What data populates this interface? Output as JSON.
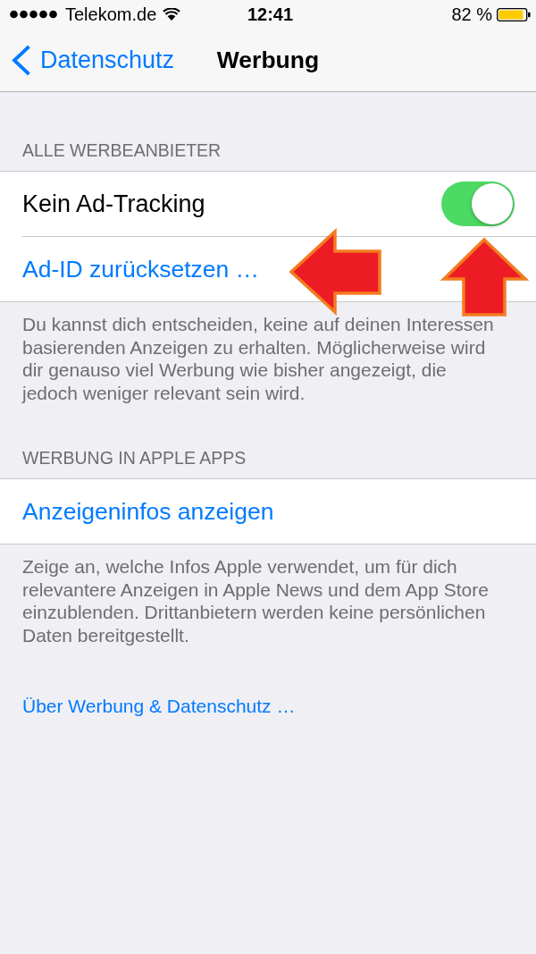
{
  "status_bar": {
    "carrier": "Telekom.de",
    "time": "12:41",
    "battery": "82 %"
  },
  "nav_bar": {
    "back": "Datenschutz",
    "title": "Werbung"
  },
  "sections": [
    {
      "header": "ALLE WERBEANBIETER",
      "rows": [
        {
          "kind": "toggle",
          "label": "Kein Ad-Tracking",
          "on": true
        },
        {
          "kind": "link",
          "label": "Ad-ID zurücksetzen …"
        }
      ],
      "footer": "Du kannst dich entscheiden, keine auf deinen Interessen basierenden Anzeigen zu erhalten. Möglicherweise wird dir genauso viel Werbung wie bisher angezeigt, die jedoch weniger relevant sein wird.",
      "annotations": [
        {
          "kind": "left"
        },
        {
          "kind": "up"
        }
      ]
    },
    {
      "header": "WERBUNG IN APPLE APPS",
      "rows": [
        {
          "kind": "link",
          "label": "Anzeigeninfos anzeigen"
        }
      ],
      "footer": "Zeige an, welche Infos Apple verwendet, um für dich relevantere Anzeigen in Apple News und dem App Store einzublenden. Drittanbietern werden keine persönlichen Daten bereitgestellt."
    }
  ],
  "footer_link": "Über Werbung & Datenschutz …"
}
